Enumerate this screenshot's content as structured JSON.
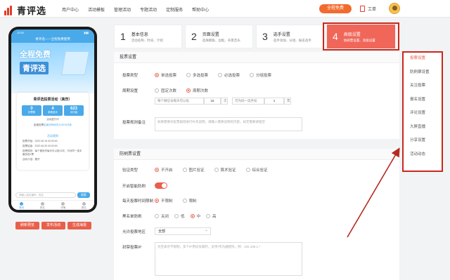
{
  "brand": {
    "name": "青评选"
  },
  "nav": [
    "用户中心",
    "活动模板",
    "管理活动",
    "专题活动",
    "定制服务",
    "帮助中心"
  ],
  "header": {
    "free_button": "全程免费",
    "work_order": "工单"
  },
  "phone": {
    "status_time": "10:50",
    "title": "青评选——全程免费使用",
    "banner_line1": "全程免费",
    "banner_line2": "青评选",
    "activity_name": "青评选投票活动（真伤）",
    "stats": [
      {
        "value": "0",
        "label": "总票数"
      },
      {
        "value": "4",
        "label": "参赛选手"
      },
      {
        "value": "623",
        "label": "访问量"
      }
    ],
    "status_line": "活动进行中",
    "countdown_prefix": "距离投票",
    "countdown_value": "结束还有88天10分10分钟",
    "rules_title": "活动规则",
    "rules": [
      "投票开始：2022.06.15 00:00:00",
      "投票结束：2022.06.30 00:00:00",
      "投票规则：每个微信号每天可以投15次，可对同一选手最多投1票",
      "活动介绍：展开"
    ],
    "search_placeholder": "请输入选手编号、姓名",
    "search_button": "搜索",
    "tabs": [
      "首页",
      "排名",
      "详情",
      "报名"
    ],
    "buttons": [
      "刷新预览",
      "发布活动",
      "生成海报"
    ]
  },
  "steps": [
    {
      "num": "1",
      "title": "基本信息",
      "sub": "活动名称、时间、介绍"
    },
    {
      "num": "2",
      "title": "页面设置",
      "sub": "选择模板、边框、背景音乐"
    },
    {
      "num": "3",
      "title": "选手设置",
      "sub": "选手添加、分组、报名选手"
    },
    {
      "num": "4",
      "title": "高级设置",
      "sub": "防刷票设置、高级设置"
    }
  ],
  "vote_section": {
    "title": "投票设置",
    "vote_type_label": "投票类型",
    "vote_types": [
      "单选投票",
      "多选投票",
      "必选投票",
      "分组投票"
    ],
    "cycle_label": "周期设置",
    "cycles": [
      "固定次数",
      "周期次数"
    ],
    "per_day_prefix": "每个微信号每天可以投",
    "per_day_value": "15",
    "per_day_unit": "次",
    "same_player_prefix": "可为同一选手投",
    "same_player_value": "1",
    "same_player_unit": "票",
    "note_label": "投票规则备注",
    "note_placeholder": "如果需要对投票规则进行补充说明，请输入需要说明的内容，如无需要请留空"
  },
  "anti_section": {
    "title": "防刷票设置",
    "verify_label": "验证类型",
    "verify_opts": [
      "不开启",
      "图片验证",
      "算术验证",
      "综合验证"
    ],
    "smart_label": "开启智能防刷",
    "limit_label": "每天投票时间限制",
    "limit_opts": [
      "不限制",
      "限制"
    ],
    "blacklist_label": "黑名单防刷",
    "blacklist_opts": [
      "关闭",
      "低",
      "中",
      "高"
    ],
    "region_label": "允许投票地区",
    "region_value": "全部",
    "ip_label": "封禁投票IP",
    "ip_placeholder": "为空表示不限制，多个IP用逗号隔开，支持*作为通配符，例：192.168.1.*"
  },
  "right_nav": [
    "投票设置",
    "防刷票设置",
    "关注投票",
    "报名设置",
    "评论设置",
    "大屏直播",
    "分享设置",
    "活动动态"
  ]
}
